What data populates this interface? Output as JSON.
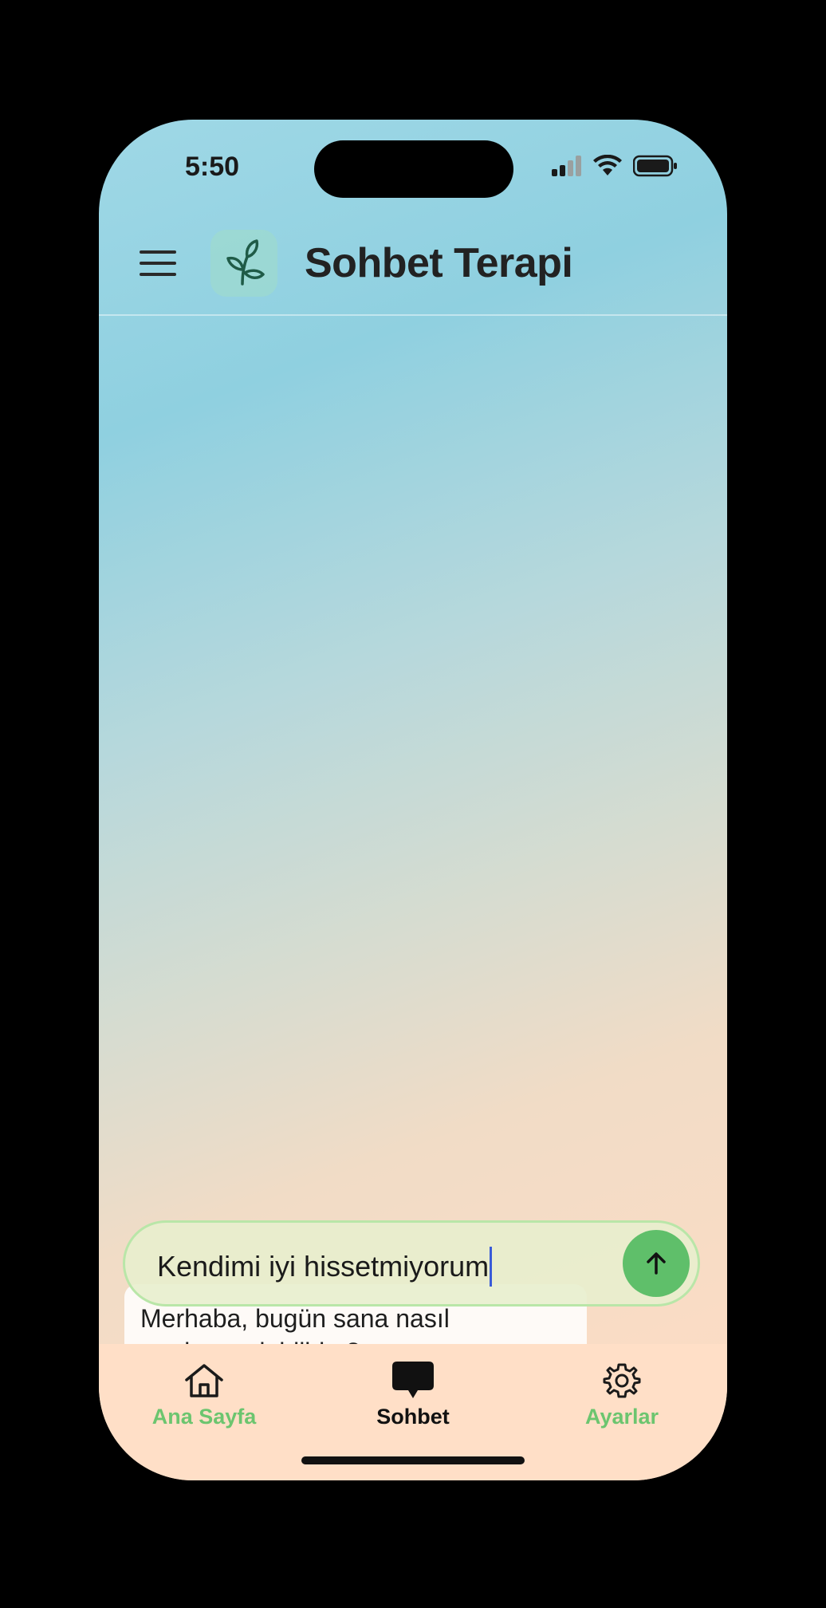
{
  "status_bar": {
    "time": "5:50",
    "icons": [
      "signal-icon",
      "wifi-icon",
      "battery-icon"
    ]
  },
  "header": {
    "menu_icon": "hamburger-menu-icon",
    "logo_icon": "leaf-sprout-icon",
    "title": "Sohbet Terapi"
  },
  "chat": {
    "messages": [
      {
        "sender": "assistant",
        "text_line1": "Merhaba, bugün sana nasıl",
        "text_line2": "yardımcı olabilirim?"
      }
    ]
  },
  "composer": {
    "value": "Kendimi iyi hissetmiyorum",
    "send_icon": "arrow-up-icon"
  },
  "tab_bar": {
    "tabs": [
      {
        "label": "Ana Sayfa",
        "icon": "home-icon",
        "active": false
      },
      {
        "label": "Sohbet",
        "icon": "chat-bubble-icon",
        "active": true
      },
      {
        "label": "Ayarlar",
        "icon": "gear-icon",
        "active": false
      }
    ]
  },
  "colors": {
    "accent_green": "#5fbf6a",
    "inactive_tab_text": "#6cc56f",
    "active_tab_text": "#111111",
    "tab_bar_bg": "#ffdfc7"
  }
}
